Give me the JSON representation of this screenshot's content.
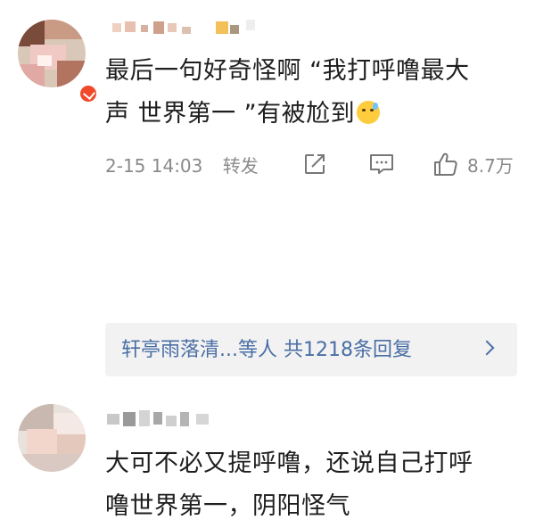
{
  "comments": [
    {
      "text_lines": [
        "最后一句好奇怪啊 “我打呼噜最大",
        "声 世界第一 ”有被尬到"
      ],
      "emoji": "sweat-smile-emoji",
      "time": "2-15 14:03",
      "repost_label": "转发",
      "like_count": "8.7万"
    },
    {
      "text_lines": [
        "大可不必又提呼噜，还说自己打呼",
        "噜世界第一，阴阳怪气"
      ],
      "replies_text": "轩亭雨落清...等人 共1218条回复"
    }
  ],
  "colors": {
    "text": "#1e1e1e",
    "meta": "#8a8a8a",
    "link": "#4a6fa5",
    "reply_bg": "#f2f2f2",
    "badge": "#f14a2b"
  }
}
